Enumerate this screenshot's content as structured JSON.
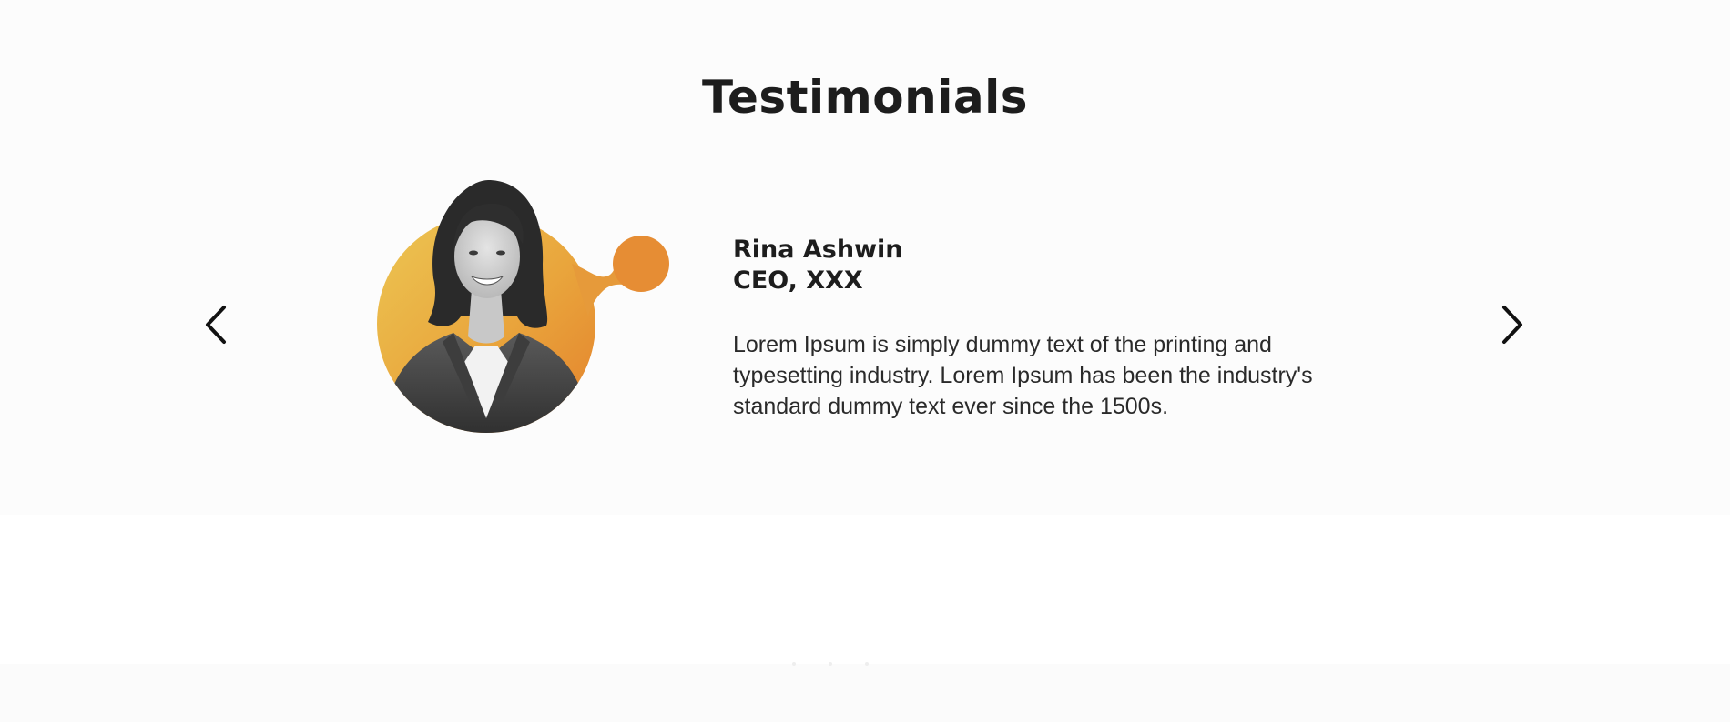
{
  "section": {
    "title": "Testimonials"
  },
  "carousel": {
    "prev_icon": "chevron-left-icon",
    "next_icon": "chevron-right-icon",
    "slide_count": 3,
    "active_slide": 1
  },
  "testimonial": {
    "name": "Rina Ashwin",
    "role": "CEO, XXX",
    "quote": "Lorem Ipsum is simply dummy text of the printing and typesetting industry. Lorem Ipsum has been the industry's standard dummy text ever since the 1500s."
  },
  "colors": {
    "accent_light": "#ecc24e",
    "accent_dark": "#e5862e",
    "text": "#1d1d1d"
  }
}
